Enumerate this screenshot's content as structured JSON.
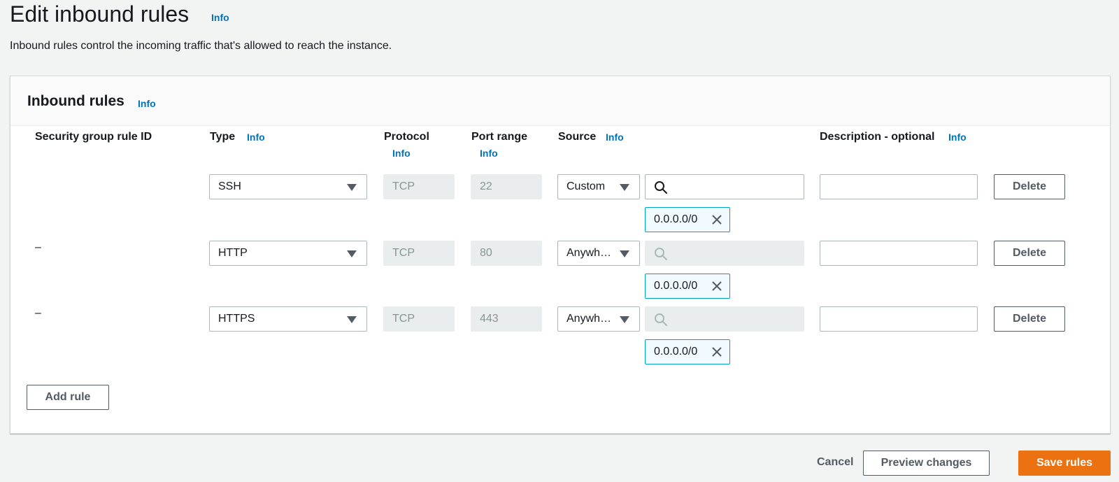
{
  "page": {
    "title": "Edit inbound rules",
    "title_info": "Info",
    "description": "Inbound rules control the incoming traffic that's allowed to reach the instance."
  },
  "panel": {
    "title": "Inbound rules",
    "title_info": "Info",
    "columns": {
      "rule_id": "Security group rule ID",
      "type": "Type",
      "type_info": "Info",
      "protocol": "Protocol",
      "protocol_info": "Info",
      "port_range": "Port range",
      "port_range_info": "Info",
      "source": "Source",
      "source_info": "Info",
      "description": "Description - optional",
      "description_info": "Info"
    },
    "rows": [
      {
        "rule_id": "",
        "type": "SSH",
        "protocol": "TCP",
        "port_range": "22",
        "source_type": "Custom",
        "source_search": "",
        "cidr": "0.0.0.0/0",
        "description": "",
        "delete_label": "Delete"
      },
      {
        "rule_id": "–",
        "type": "HTTP",
        "protocol": "TCP",
        "port_range": "80",
        "source_type": "Anywh…",
        "source_search": "",
        "cidr": "0.0.0.0/0",
        "description": "",
        "delete_label": "Delete"
      },
      {
        "rule_id": "–",
        "type": "HTTPS",
        "protocol": "TCP",
        "port_range": "443",
        "source_type": "Anywh…",
        "source_search": "",
        "cidr": "0.0.0.0/0",
        "description": "",
        "delete_label": "Delete"
      }
    ],
    "add_rule_label": "Add rule"
  },
  "footer": {
    "cancel_label": "Cancel",
    "preview_label": "Preview changes",
    "save_label": "Save rules"
  },
  "colors": {
    "accent": "#ec7211",
    "link": "#0073bb",
    "token_border": "#00a1c9"
  },
  "icons": {
    "caret": "caret-down-icon",
    "search": "search-icon",
    "remove": "close-icon"
  }
}
